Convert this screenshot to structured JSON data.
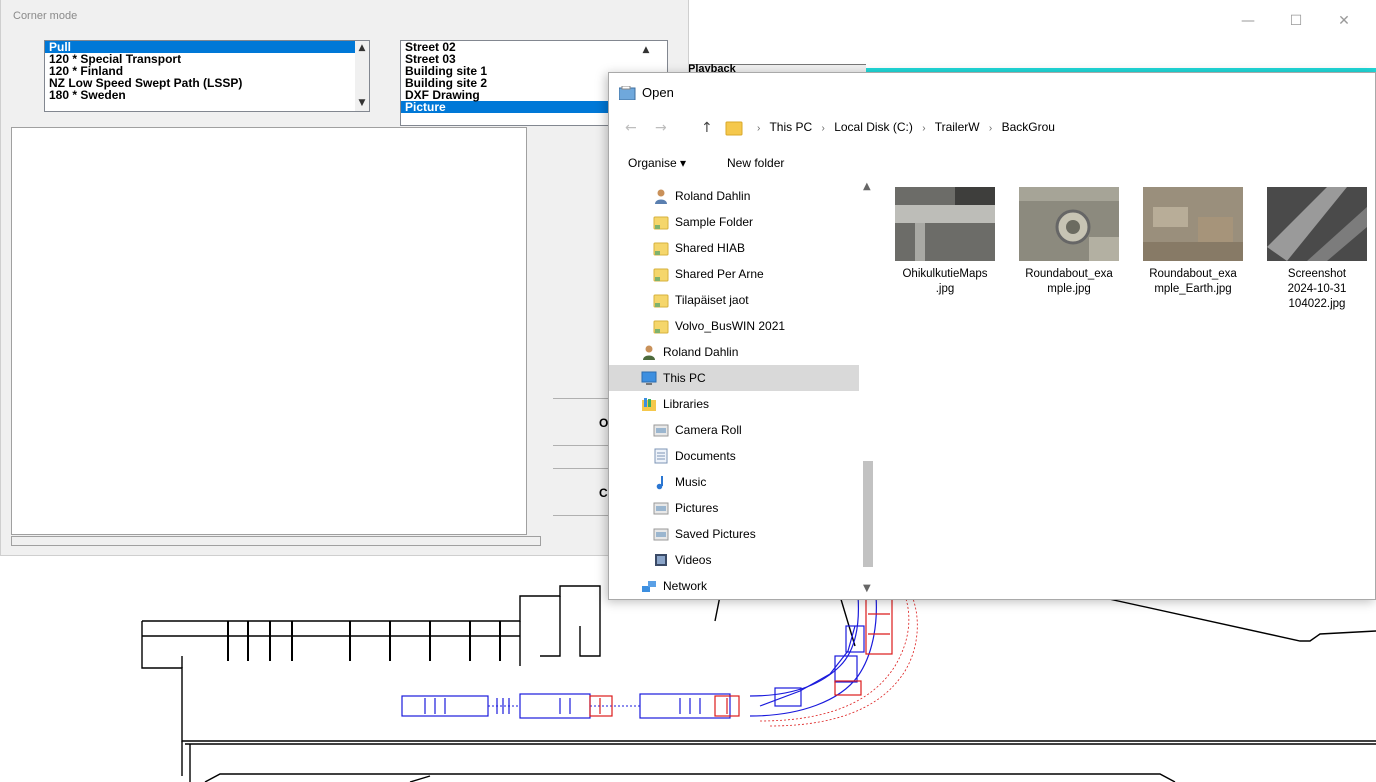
{
  "background_app": {
    "playback_tab_label": "Playback",
    "window_controls": {
      "minimize": "—",
      "maximize": "☐",
      "close": "✕"
    }
  },
  "corner_dialog": {
    "title": "Corner mode",
    "vehicle_list": {
      "items": [
        "Pull",
        "120 * Special Transport",
        "120 * Finland",
        "NZ Low Speed Swept Path (LSSP)",
        "180 * Sweden"
      ],
      "selected_index": 0
    },
    "background_list": {
      "items": [
        "Street 02",
        "Street 03",
        "Building site 1",
        "Building site 2",
        "DXF Drawing",
        "Picture"
      ],
      "selected_index": 5
    },
    "ok_label": "OK",
    "cancel_label": "Cancel"
  },
  "open_dialog": {
    "title": "Open",
    "breadcrumb": [
      "This PC",
      "Local Disk (C:)",
      "TrailerW",
      "BackGrou"
    ],
    "organise_label": "Organise ▾",
    "new_folder_label": "New folder",
    "nav_items": [
      {
        "label": "Roland Dahlin",
        "icon": "user-folder-icon",
        "indent": 1
      },
      {
        "label": "Sample Folder",
        "icon": "shared-folder-icon",
        "indent": 1
      },
      {
        "label": "Shared HIAB",
        "icon": "shared-folder-icon",
        "indent": 1
      },
      {
        "label": "Shared Per Arne",
        "icon": "shared-folder-icon",
        "indent": 1
      },
      {
        "label": "Tilapäiset jaot",
        "icon": "shared-folder-icon",
        "indent": 1
      },
      {
        "label": "Volvo_BusWIN 2021",
        "icon": "shared-folder-icon",
        "indent": 1
      },
      {
        "label": "Roland Dahlin",
        "icon": "user-icon",
        "indent": 0
      },
      {
        "label": "This PC",
        "icon": "computer-icon",
        "indent": 0
      },
      {
        "label": "Libraries",
        "icon": "libraries-icon",
        "indent": 0
      },
      {
        "label": "Camera Roll",
        "icon": "picture-library-icon",
        "indent": 1
      },
      {
        "label": "Documents",
        "icon": "documents-icon",
        "indent": 1
      },
      {
        "label": "Music",
        "icon": "music-icon",
        "indent": 1
      },
      {
        "label": "Pictures",
        "icon": "picture-library-icon",
        "indent": 1
      },
      {
        "label": "Saved Pictures",
        "icon": "picture-library-icon",
        "indent": 1
      },
      {
        "label": "Videos",
        "icon": "videos-icon",
        "indent": 1
      },
      {
        "label": "Network",
        "icon": "network-icon",
        "indent": 0
      }
    ],
    "selected_nav_index": 7,
    "files": [
      {
        "name": "OhikulkutieMaps.jpg",
        "label_lines": [
          "OhikulkutieMaps",
          ".jpg"
        ]
      },
      {
        "name": "Roundabout_example.jpg",
        "label_lines": [
          "Roundabout_exa",
          "mple.jpg"
        ]
      },
      {
        "name": "Roundabout_example_Earth.jpg",
        "label_lines": [
          "Roundabout_exa",
          "mple_Earth.jpg"
        ]
      },
      {
        "name": "Screenshot 2024-10-31 104022.jpg",
        "label_lines": [
          "Screenshot",
          "2024-10-31",
          "104022.jpg"
        ]
      }
    ]
  },
  "colors": {
    "selection_blue": "#0078d7",
    "drawing_blue": "#1a1adc",
    "drawing_red": "#dc1a1a",
    "cyan_bar": "#20d8d8"
  }
}
